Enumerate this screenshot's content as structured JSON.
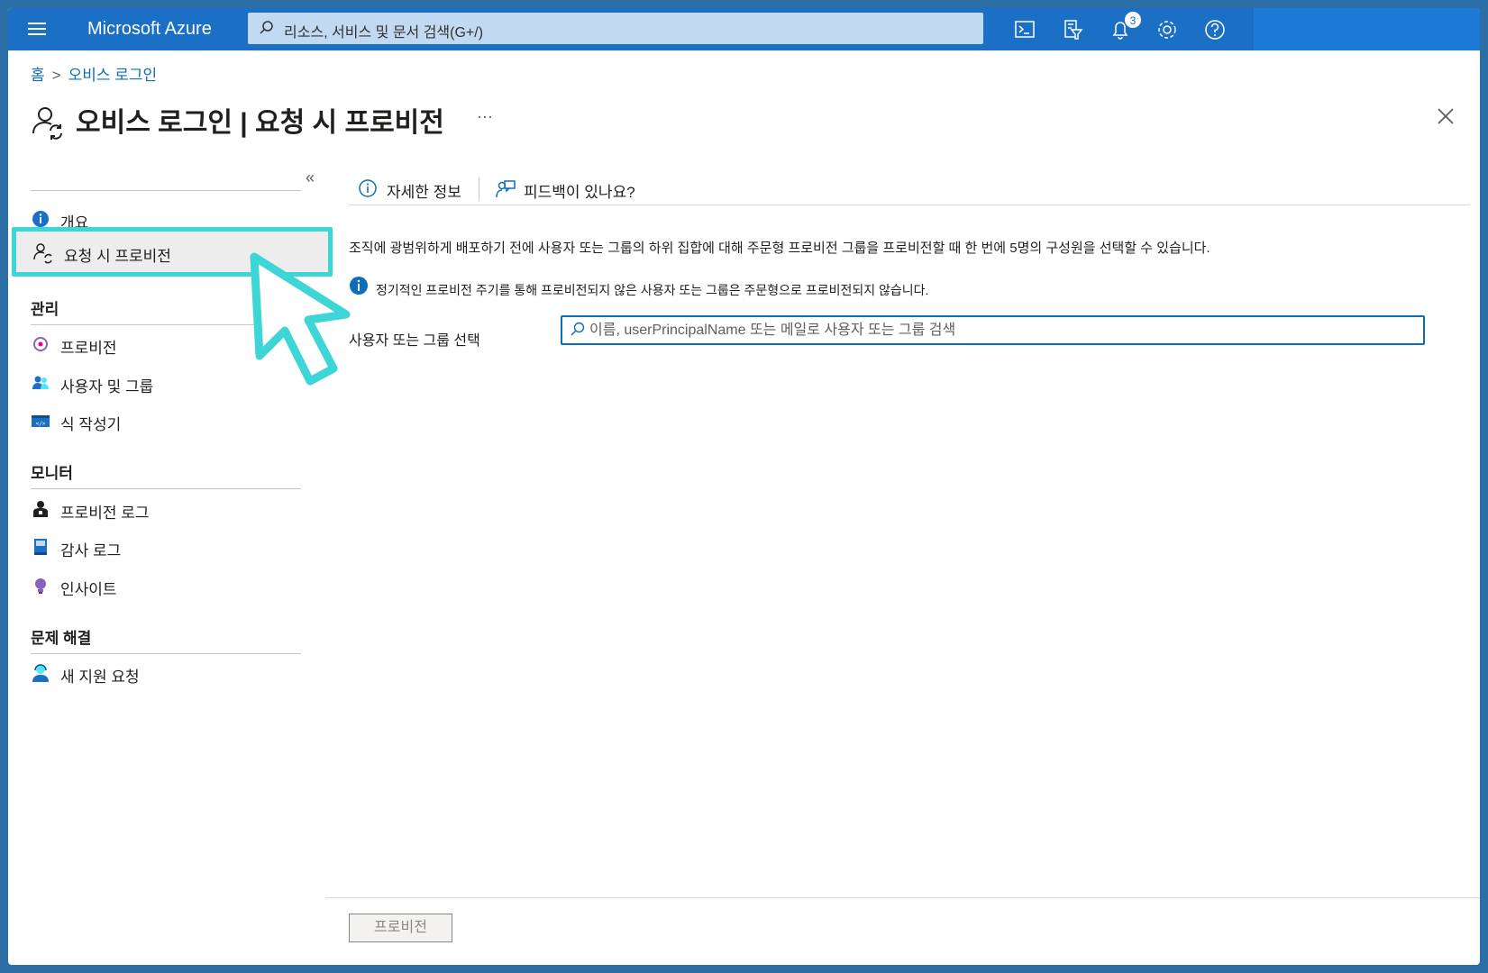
{
  "topbar": {
    "brand": "Microsoft Azure",
    "search_placeholder": "리소스, 서비스 및 문서 검색(G+/)",
    "notification_count": "3",
    "icons": [
      "cloud-shell-icon",
      "directory-filter-icon",
      "notifications-icon",
      "settings-icon",
      "help-icon"
    ]
  },
  "breadcrumb": {
    "home": "홈",
    "current": "오비스 로그인"
  },
  "header": {
    "title": "오비스 로그인 | 요청 시 프로비전",
    "more": "···"
  },
  "sidebar": {
    "collapse": "«",
    "items": [
      {
        "label": "개요",
        "icon": "info-icon"
      },
      {
        "label": "요청 시 프로비전",
        "icon": "user-sync-icon",
        "active": true
      }
    ],
    "groups": [
      {
        "title": "관리",
        "items": [
          {
            "label": "프로비전",
            "icon": "provisioning-icon"
          },
          {
            "label": "사용자 및 그룹",
            "icon": "users-groups-icon"
          },
          {
            "label": "식 작성기",
            "icon": "expression-builder-icon"
          }
        ]
      },
      {
        "title": "모니터",
        "items": [
          {
            "label": "프로비전 로그",
            "icon": "provisioning-log-icon"
          },
          {
            "label": "감사 로그",
            "icon": "audit-log-icon"
          },
          {
            "label": "인사이트",
            "icon": "insights-icon"
          }
        ]
      },
      {
        "title": "문제 해결",
        "items": [
          {
            "label": "새 지원 요청",
            "icon": "support-request-icon"
          }
        ]
      }
    ]
  },
  "toolbar": {
    "learn_more": "자세한 정보",
    "feedback": "피드백이 있나요?"
  },
  "main": {
    "description": "조직에 광범위하게 배포하기 전에 사용자 또는 그룹의 하위 집합에 대해 주문형 프로비전 그룹을 프로비전할 때 한 번에 5명의 구성원을 선택할 수 있습니다.",
    "info": "정기적인 프로비전 주기를 통해 프로비전되지 않은 사용자 또는 그룹은 주문형으로 프로비전되지 않습니다.",
    "field_label": "사용자 또는 그룹 선택",
    "search_placeholder": "이름, userPrincipalName 또는 메일로 사용자 또는 그룹 검색",
    "search_value": ""
  },
  "footer": {
    "provision_button": "프로비전"
  },
  "colors": {
    "topbar": "#1b6fc4",
    "accent": "#0f6cbd",
    "highlight": "#3dd5d5"
  }
}
